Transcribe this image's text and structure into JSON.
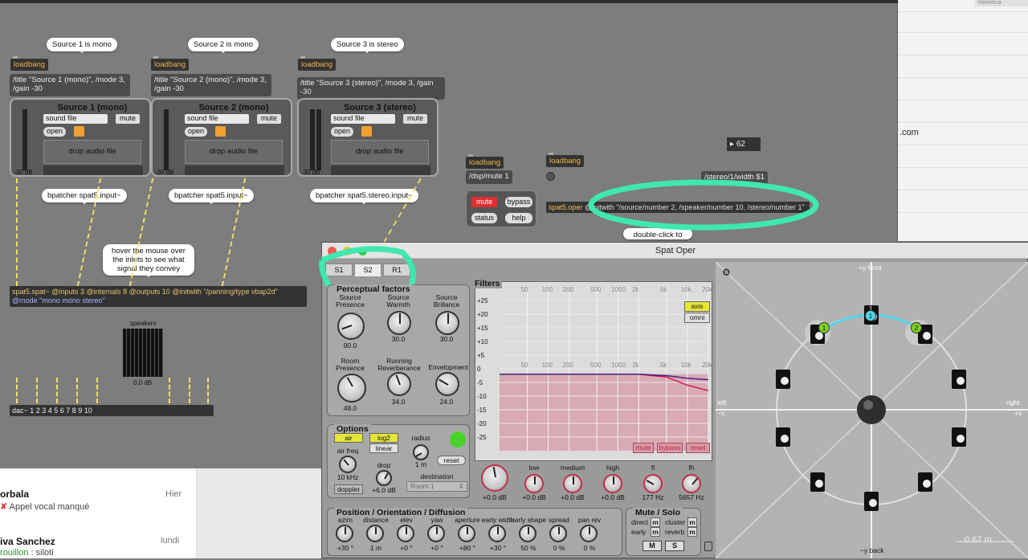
{
  "patcher": {
    "bubbles": [
      "Source 1 is mono",
      "Source 2 is mono",
      "Source 3 is stereo",
      "hover the mouse over the inlets to see what signal they convey",
      "double-click to open the window"
    ],
    "loadbang": "loadbang",
    "msg1": "/title \"Source 1 (mono)\", /mode 3, /gain -30",
    "msg2": "/title \"Source 2 (mono)\", /mode 3, /gain -30",
    "msg3": "/title \"Source 3 (stereo)\", /mode 3, /gain -30",
    "sources": [
      {
        "title": "Source 1 (mono)",
        "bpatcher": "bpatcher spat5.input~"
      },
      {
        "title": "Source 2 (mono)",
        "bpatcher": "bpatcher spat5.input~"
      },
      {
        "title": "Source 3 (stereo)",
        "bpatcher": "bpatcher spat5.stereo.input~"
      }
    ],
    "source_ui": {
      "select": "sound file",
      "mute": "mute",
      "open": "open",
      "drop": "drop audio file",
      "db": "-30 dB"
    },
    "dsp_msg": "/dsp/mute 1",
    "mute_btn": "mute",
    "bypass_btn": "bypass",
    "status_btn": "status",
    "help_btn": "help",
    "number_box": "62",
    "width_msg": "/stereo/1/width $1",
    "oper_obj_name": "spat5.oper",
    "oper_obj_args": "@initwith \"/source/number 2, /speaker/number 10, /stereo/number 1\"",
    "spat_obj_line1": "spat5.spat~ @inputs 3 @internals 8 @outputs 10 @initwith \"/panning/type vbap2d\"",
    "spat_obj_line2": "@mode \"mono mono stereo\"",
    "speakers_label": "speakers",
    "speakers_db": "0.0 dB",
    "dac": "dac~ 1 2 3 4 5 6 7 8 9 10"
  },
  "rightapp": {
    "header": "Helvetica",
    "domain": ".com"
  },
  "chat": [
    {
      "name": "orbala",
      "time": "Hier",
      "sub": "Appel vocal manqué",
      "sub_color": "#444"
    },
    {
      "name": "iva Sanchez",
      "time": "lundi",
      "sub_prefix": "rouillon",
      "sub": " : siloti",
      "sub_color": "#2e8b2e"
    }
  ],
  "spat": {
    "window_title": "Spat Oper",
    "tabs": [
      "S1",
      "S2",
      "R1"
    ],
    "active_tab": "S2",
    "perceptual": {
      "title": "Perceptual factors",
      "knobs": [
        {
          "label": "Source Presence",
          "value": "90.0"
        },
        {
          "label": "Source Warmth",
          "value": "30.0"
        },
        {
          "label": "Source Brillance",
          "value": "30.0"
        },
        {
          "label": "Room Presence",
          "value": "48.0"
        },
        {
          "label": "Running Reverberance",
          "value": "34.0"
        },
        {
          "label": "Envelopment",
          "value": "24.0"
        }
      ]
    },
    "options": {
      "title": "Options",
      "air": "air",
      "log2": "log2",
      "linear": "linear",
      "radius": "radius",
      "radius_val": "1 m",
      "reset": "reset",
      "air_freq": "air freq",
      "air_freq_val": "10 kHz",
      "drop": "drop",
      "drop_val": "+6.0 dB",
      "doppler": "doppler",
      "destination": "destination",
      "destination_val": "Room 1"
    },
    "filters": {
      "title": "Filters",
      "freq_ticks": [
        "50",
        "100",
        "200",
        "500",
        "1000",
        "2k",
        "5k",
        "10k",
        "20k"
      ],
      "db_ticks": [
        "+25",
        "+20",
        "+15",
        "+10",
        "+5",
        "0",
        "-5",
        "-10",
        "-15",
        "-20",
        "-25"
      ],
      "axis": "axis",
      "omni": "omni",
      "mute": "mute",
      "bypass": "bypass",
      "reset": "reset",
      "knobs": [
        {
          "label": "",
          "value": "+0.0 dB"
        },
        {
          "label": "low",
          "value": "+0.0 dB"
        },
        {
          "label": "medium",
          "value": "+0.0 dB"
        },
        {
          "label": "high",
          "value": "+0.0 dB"
        },
        {
          "label": "fl",
          "value": "177 Hz"
        },
        {
          "label": "fh",
          "value": "5657 Hz"
        }
      ]
    },
    "position": {
      "title": "Position / Orientation / Diffusion",
      "knobs": [
        {
          "label": "azim",
          "value": "+30 °"
        },
        {
          "label": "distance",
          "value": "1 m"
        },
        {
          "label": "elev",
          "value": "+0 °"
        },
        {
          "label": "yaw",
          "value": "+0 °"
        },
        {
          "label": "aperture",
          "value": "+80 °"
        },
        {
          "label": "early width",
          "value": "+30 °"
        },
        {
          "label": "early shape",
          "value": "50 %"
        },
        {
          "label": "spread",
          "value": "0 %"
        },
        {
          "label": "pan rev",
          "value": "0 %"
        }
      ]
    },
    "mutesolo": {
      "title": "Mute / Solo",
      "direct": "direct",
      "early": "early",
      "cluster": "cluster",
      "reverb": "reverb",
      "m": "m",
      "M": "M",
      "S": "S"
    },
    "radar": {
      "front": "+y front",
      "back": "−y back",
      "left": "left",
      "minus_x": "−x",
      "right": "right",
      "plus_x": "+x",
      "scale": "0.67 m",
      "src1": "1",
      "src2": "2",
      "spk_top": "1"
    }
  },
  "chart_data": {
    "type": "line",
    "title": "Filters",
    "xlabel": "",
    "ylabel": "",
    "x": [
      20,
      50,
      100,
      200,
      500,
      1000,
      2000,
      5000,
      10000,
      20000
    ],
    "xscale": "log",
    "ylim": [
      -30,
      30
    ],
    "series": [
      {
        "values": [
          -2,
          -2,
          -2,
          -2,
          -2,
          -2,
          -2,
          -3,
          -6,
          -8
        ]
      },
      {
        "values": [
          -2,
          -2,
          -2,
          -2,
          -2,
          -2,
          -2,
          -2.5,
          -3.5,
          -4
        ]
      }
    ]
  }
}
